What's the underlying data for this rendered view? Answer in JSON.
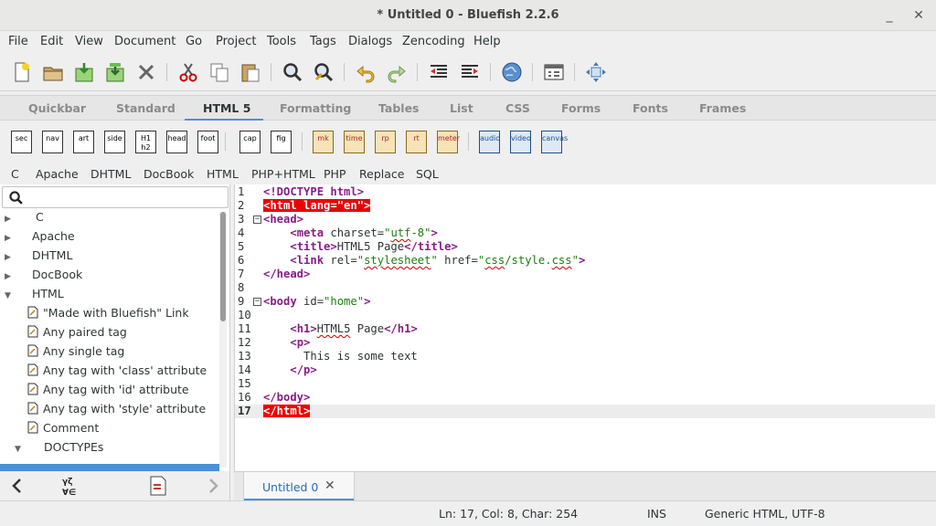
{
  "window": {
    "title": "* Untitled 0 - Bluefish 2.2.6"
  },
  "menubar": [
    "File",
    "Edit",
    "View",
    "Document",
    "Go",
    "Project",
    "Tools",
    "Tags",
    "Dialogs",
    "Zencoding",
    "Help"
  ],
  "toolbar": [
    "new-file-icon",
    "open-file-icon",
    "save-icon",
    "save-as-icon",
    "close-icon",
    "cut-icon",
    "copy-icon",
    "paste-icon",
    "find-icon",
    "find-replace-icon",
    "undo-icon",
    "redo-icon",
    "unindent-icon",
    "indent-icon",
    "preview-browser-icon",
    "preferences-icon",
    "fullscreen-icon"
  ],
  "tabs": [
    "Quickbar",
    "Standard",
    "HTML 5",
    "Formatting",
    "Tables",
    "List",
    "CSS",
    "Forms",
    "Fonts",
    "Frames"
  ],
  "active_tab": "HTML 5",
  "tag_buttons": [
    "sec",
    "nav",
    "art",
    "side",
    "H1 h2",
    "head",
    "foot",
    "cap",
    "fig",
    "mk",
    "time",
    "rp",
    "rt",
    "meter",
    "audio",
    "video",
    "canvas"
  ],
  "filter_menu": [
    "C",
    "Apache",
    "DHTML",
    "DocBook",
    "HTML",
    "PHP+HTML",
    "PHP",
    "Replace",
    "SQL"
  ],
  "sidebar": {
    "search": {
      "value": "",
      "placeholder": ""
    },
    "tree": [
      {
        "label": "C",
        "kind": "group",
        "expanded": false
      },
      {
        "label": "Apache",
        "kind": "group",
        "expanded": false
      },
      {
        "label": "DHTML",
        "kind": "group",
        "expanded": false
      },
      {
        "label": "DocBook",
        "kind": "group",
        "expanded": false
      },
      {
        "label": "HTML",
        "kind": "group",
        "expanded": true
      },
      {
        "label": "\"Made with Bluefish\" Link",
        "kind": "leaf"
      },
      {
        "label": "Any paired tag",
        "kind": "leaf"
      },
      {
        "label": "Any single tag",
        "kind": "leaf"
      },
      {
        "label": "Any tag with 'class' attribute",
        "kind": "leaf"
      },
      {
        "label": "Any tag with 'id' attribute",
        "kind": "leaf"
      },
      {
        "label": "Any tag with 'style' attribute",
        "kind": "leaf"
      },
      {
        "label": "Comment",
        "kind": "leaf"
      },
      {
        "label": "DOCTYPEs",
        "kind": "subgroup",
        "expanded": true
      }
    ]
  },
  "editor": {
    "lines": [
      [
        [
          "tag",
          "<!DOCTYPE html>"
        ]
      ],
      [
        [
          "err",
          "<html lang=\"en\">"
        ]
      ],
      [
        [
          "tag",
          "<head>"
        ]
      ],
      [
        [
          "txt",
          "    "
        ],
        [
          "tag",
          "<meta "
        ],
        [
          "attr",
          "charset="
        ],
        [
          "str",
          "\""
        ],
        [
          "strsq",
          "utf"
        ],
        [
          "str",
          "-8\""
        ],
        [
          "tag",
          ">"
        ]
      ],
      [
        [
          "txt",
          "    "
        ],
        [
          "tag",
          "<title>"
        ],
        [
          "txt",
          "HTML5 Page"
        ],
        [
          "tag",
          "</title>"
        ]
      ],
      [
        [
          "txt",
          "    "
        ],
        [
          "tag",
          "<link "
        ],
        [
          "attr",
          "rel="
        ],
        [
          "str",
          "\""
        ],
        [
          "strsq",
          "stylesheet"
        ],
        [
          "str",
          "\""
        ],
        [
          "attr",
          " href="
        ],
        [
          "str",
          "\""
        ],
        [
          "strsq",
          "css"
        ],
        [
          "str",
          "/style."
        ],
        [
          "strsq",
          "css"
        ],
        [
          "str",
          "\""
        ],
        [
          "tag",
          ">"
        ]
      ],
      [
        [
          "tag",
          "</head>"
        ]
      ],
      [],
      [
        [
          "tag",
          "<body "
        ],
        [
          "attr",
          "id="
        ],
        [
          "str",
          "\"home\""
        ],
        [
          "tag",
          ">"
        ]
      ],
      [],
      [
        [
          "txt",
          "    "
        ],
        [
          "tag",
          "<h1>"
        ],
        [
          "txtsq",
          "HTML5"
        ],
        [
          "txt",
          " Page"
        ],
        [
          "tag",
          "</h1>"
        ]
      ],
      [
        [
          "txt",
          "    "
        ],
        [
          "tag",
          "<p>"
        ]
      ],
      [
        [
          "txt",
          "      This is some text"
        ]
      ],
      [
        [
          "txt",
          "    "
        ],
        [
          "tag",
          "</p>"
        ]
      ],
      [],
      [
        [
          "tag",
          "</body>"
        ]
      ],
      [
        [
          "err",
          "</html>"
        ]
      ]
    ],
    "fold_lines": [
      3,
      9
    ],
    "current_line": 17
  },
  "document_tab": {
    "label": "Untitled 0"
  },
  "status": {
    "position": "Ln: 17, Col: 8, Char: 254",
    "mode": "INS",
    "encoding": "Generic HTML, UTF-8"
  },
  "colors": {
    "accent": "#4a90d9",
    "tag": "#8a1c8a",
    "string": "#1b7f0b",
    "error": "#ee0000"
  }
}
